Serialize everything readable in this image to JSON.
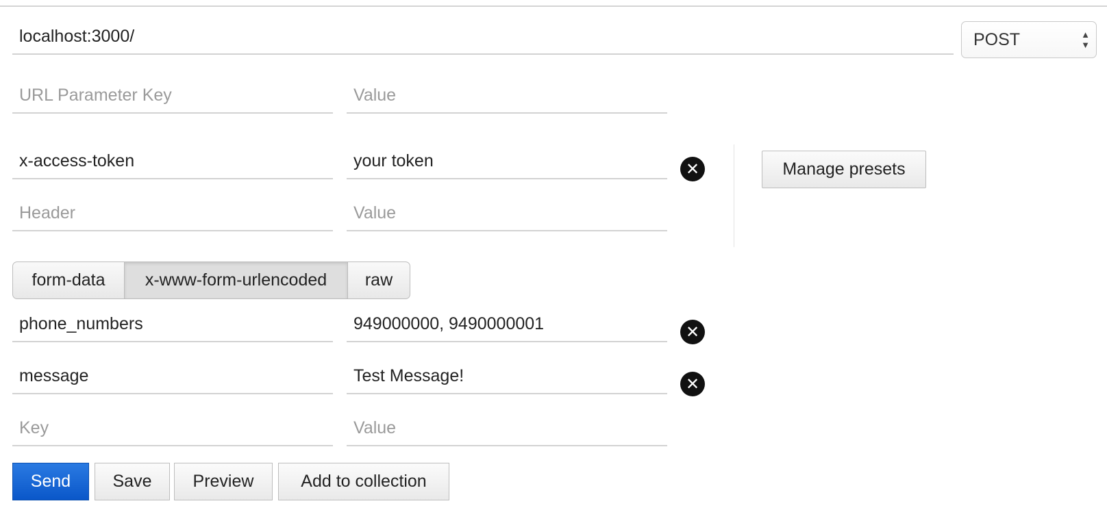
{
  "request": {
    "url_value": "localhost:3000/",
    "method": "POST"
  },
  "url_params": {
    "key_placeholder": "URL Parameter Key",
    "value_placeholder": "Value"
  },
  "headers": {
    "rows": [
      {
        "key": "x-access-token",
        "value": "your token"
      }
    ],
    "key_placeholder": "Header",
    "value_placeholder": "Value",
    "manage_presets_label": "Manage presets"
  },
  "body_tabs": [
    {
      "label": "form-data",
      "active": false
    },
    {
      "label": "x-www-form-urlencoded",
      "active": true
    },
    {
      "label": "raw",
      "active": false
    }
  ],
  "body": {
    "rows": [
      {
        "key": "phone_numbers",
        "value": "949000000, 9490000001"
      },
      {
        "key": "message",
        "value": "Test Message!"
      }
    ],
    "key_placeholder": "Key",
    "value_placeholder": "Value"
  },
  "actions": {
    "send_label": "Send",
    "save_label": "Save",
    "preview_label": "Preview",
    "add_to_collection_label": "Add to collection"
  },
  "icons": {
    "remove": "close-circle-icon",
    "method_arrows": "sort-arrows-icon"
  },
  "colors": {
    "send_button": "#0a57c9",
    "remove_icon": "#111111",
    "field_border": "#d2d2d2"
  }
}
